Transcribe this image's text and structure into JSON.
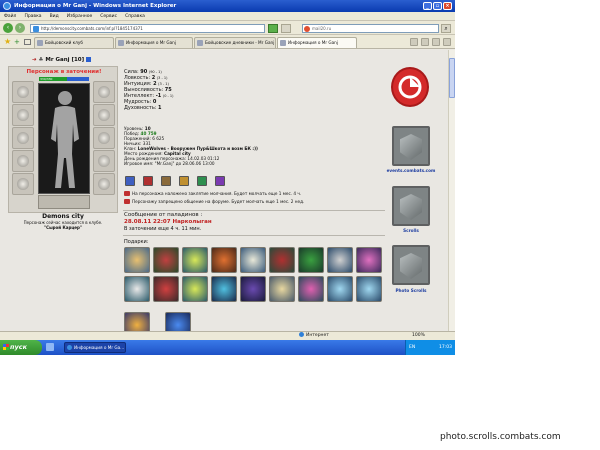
{
  "window": {
    "title": "Информация о Mr Ganj - Windows Internet Explorer"
  },
  "menu": [
    "Файл",
    "Правка",
    "Вид",
    "Избранное",
    "Сервис",
    "Справка"
  ],
  "address": {
    "url": "http://demonscity.combats.com/inf.pl?1845174371",
    "search_value": "mail20.ru"
  },
  "tabs": [
    {
      "label": "Бойцовский клуб"
    },
    {
      "label": "Информация о Mr Ganj"
    },
    {
      "label": "Бойцовские дневники - Mr Ganj"
    },
    {
      "label": "Информация о Mr Ganj",
      "active": true
    }
  ],
  "character": {
    "name": "Mr Ganj",
    "level": "[10]",
    "jail_status": "Персонаж в заточении!",
    "city": "Demons city",
    "clan_note": "Персонаж сейчас находится в клубе.",
    "location": "\"Сырой Карцер\"",
    "hp": "330/330"
  },
  "stats": [
    {
      "label": "Сила:",
      "value": "90",
      "extra": "(90 - 1)"
    },
    {
      "label": "Ловкость:",
      "value": "2",
      "extra": "(3 - 1)"
    },
    {
      "label": "Интуиция:",
      "value": "2",
      "extra": "(3 - 1)"
    },
    {
      "label": "Выносливость:",
      "value": "75",
      "extra": ""
    },
    {
      "label": "Интеллект:",
      "value": "-1",
      "extra": "(0 - 1)"
    },
    {
      "label": "Мудрость:",
      "value": "0",
      "extra": ""
    },
    {
      "label": "Духовность:",
      "value": "1",
      "extra": ""
    }
  ],
  "info": [
    {
      "label": "Уровень:",
      "value": "10"
    },
    {
      "label": "Побед:",
      "value": "40 759"
    },
    {
      "label": "Поражений:",
      "value": "6 625"
    },
    {
      "label": "Ничьих:",
      "value": "331"
    },
    {
      "label": "Клан:",
      "value": "LoneWolves - Вооружен Пур&Шкота и возм БК :))"
    },
    {
      "label": "Место рождения:",
      "value": "Capital city"
    },
    {
      "label": "День рождения персонажа:",
      "value": "14.02.03 01:12"
    },
    {
      "label": "Игровое имя:",
      "value": "\"Mr.Ganj\" до 28.06.06 13:00"
    }
  ],
  "messages": [
    "На персонажа наложено заклятие молчания. Будет молчать еще 1 мес. 4 ч.",
    "Персонажу запрещено общение на форуме. Будет молчать еще 1 мес. 2 нед."
  ],
  "paladin": {
    "header": "Сообщение от паладинов :",
    "line1": "28.08.11 22:07 Нарколыган",
    "line2": "В заточении еще 4 ч. 11 мин."
  },
  "gifts_label": "Подарки:",
  "side": {
    "link1": "events.combats.com",
    "link2": "Scrolls",
    "link3": "Photo Scrolls"
  },
  "status": {
    "zone": "Интернет",
    "zoom": "100%"
  },
  "taskbar": {
    "start": "пуск",
    "item": "Информация о Mr Ga...",
    "lang": "EN",
    "time": "17:03"
  },
  "watermark": "photo.scrolls.combats.com",
  "colors": {
    "title_blue": "#0a3bb0",
    "jail_red": "#e03030",
    "paladin_red": "#c02020",
    "link_blue": "#1d3da0"
  }
}
